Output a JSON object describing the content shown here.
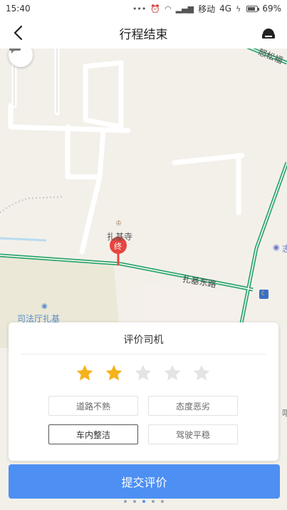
{
  "status_bar": {
    "time": "15:40",
    "carrier": "移动",
    "network": "4G",
    "battery": "69%",
    "battery_level": 0.69
  },
  "nav": {
    "title": "行程结束"
  },
  "map": {
    "road_label_top_right": "怒松福",
    "poi_temple": "扎基寺",
    "end_marker": "终",
    "road_main": "扎基东路",
    "poi_left": "司法厅扎基",
    "poi_right_glyph": "志",
    "poi_right_lower": "喀"
  },
  "rating": {
    "title": "评价司机",
    "selected_stars": 2,
    "max_stars": 5,
    "star_color": "#f5b21b",
    "star_empty_color": "#e4e4e4",
    "tags": [
      {
        "label": "道路不熟",
        "selected": false
      },
      {
        "label": "态度恶劣",
        "selected": false
      },
      {
        "label": "车内整洁",
        "selected": true
      },
      {
        "label": "驾驶平稳",
        "selected": false
      }
    ]
  },
  "submit": {
    "label": "提交评价",
    "color": "#4d8ff2"
  },
  "pager": {
    "count": 5,
    "active_index": 2
  }
}
